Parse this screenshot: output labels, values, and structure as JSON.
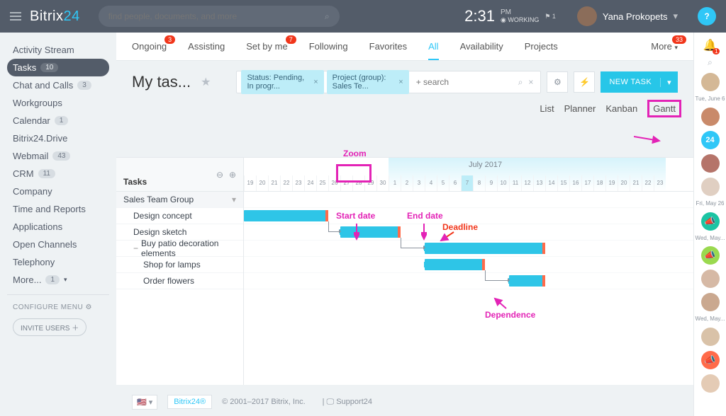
{
  "header": {
    "logo_a": "Bitrix",
    "logo_b": "24",
    "search_ph": "find people, documents, and more",
    "time": "2:31",
    "pm": "PM",
    "work_flag": "1",
    "working": "WORKING",
    "user": "Yana Prokopets"
  },
  "side": {
    "items": [
      {
        "label": "Activity Stream"
      },
      {
        "label": "Tasks",
        "count": "10",
        "active": true
      },
      {
        "label": "Chat and Calls",
        "count": "3"
      },
      {
        "label": "Workgroups"
      },
      {
        "label": "Calendar",
        "count": "1"
      },
      {
        "label": "Bitrix24.Drive"
      },
      {
        "label": "Webmail",
        "count": "43"
      },
      {
        "label": "CRM",
        "count": "11"
      },
      {
        "label": "Company"
      },
      {
        "label": "Time and Reports"
      },
      {
        "label": "Applications"
      },
      {
        "label": "Open Channels"
      },
      {
        "label": "Telephony"
      },
      {
        "label": "More...",
        "count": "1"
      }
    ],
    "configure": "CONFIGURE MENU",
    "invite": "INVITE USERS"
  },
  "tabs": {
    "items": [
      {
        "label": "Ongoing",
        "badge": "3"
      },
      {
        "label": "Assisting"
      },
      {
        "label": "Set by me",
        "badge": "7"
      },
      {
        "label": "Following"
      },
      {
        "label": "Favorites"
      },
      {
        "label": "All",
        "sel": true
      },
      {
        "label": "Availability"
      },
      {
        "label": "Projects"
      }
    ],
    "more": "More",
    "more_badge": "33"
  },
  "page": {
    "title": "My tas...",
    "chip1": "Status: Pending, In progr...",
    "chip2": "Project (group): Sales Te...",
    "search_ph": "+ search",
    "newtask": "NEW TASK"
  },
  "views": {
    "list": "List",
    "planner": "Planner",
    "kanban": "Kanban",
    "gantt": "Gantt"
  },
  "ann": {
    "zoom": "Zoom",
    "start": "Start date",
    "end": "End date",
    "deadline": "Deadline",
    "dep": "Dependence"
  },
  "gantt": {
    "left_header": "Tasks",
    "month": "July 2017",
    "days": [
      "19",
      "20",
      "21",
      "22",
      "23",
      "24",
      "25",
      "26",
      "27",
      "28",
      "29",
      "30",
      "1",
      "2",
      "3",
      "4",
      "5",
      "6",
      "7",
      "8",
      "9",
      "10",
      "11",
      "12",
      "13",
      "14",
      "15",
      "16",
      "17",
      "18",
      "19",
      "20",
      "21",
      "22",
      "23"
    ],
    "today_idx": 18,
    "rows": [
      {
        "label": "Sales Team Group",
        "grp": true
      },
      {
        "label": "Design concept",
        "indent": 1,
        "bar": [
          0,
          7
        ]
      },
      {
        "label": "Design sketch",
        "indent": 1,
        "bar": [
          8,
          13
        ]
      },
      {
        "label": "Buy patio decoration elements",
        "indent": 1,
        "exp": "−",
        "bar": [
          15,
          25
        ]
      },
      {
        "label": "Shop for lamps",
        "indent": 2,
        "bar": [
          15,
          20
        ]
      },
      {
        "label": "Order flowers",
        "indent": 2,
        "bar": [
          22,
          25
        ]
      }
    ]
  },
  "footer": {
    "copy": "© 2001–2017 Bitrix, Inc.",
    "support": "Support24",
    "b24": "Bitrix24®"
  },
  "rail": {
    "dates": [
      "Tue, June 6",
      "Fri, May 26",
      "Wed, May...",
      "Wed, May..."
    ],
    "bell": "1"
  }
}
